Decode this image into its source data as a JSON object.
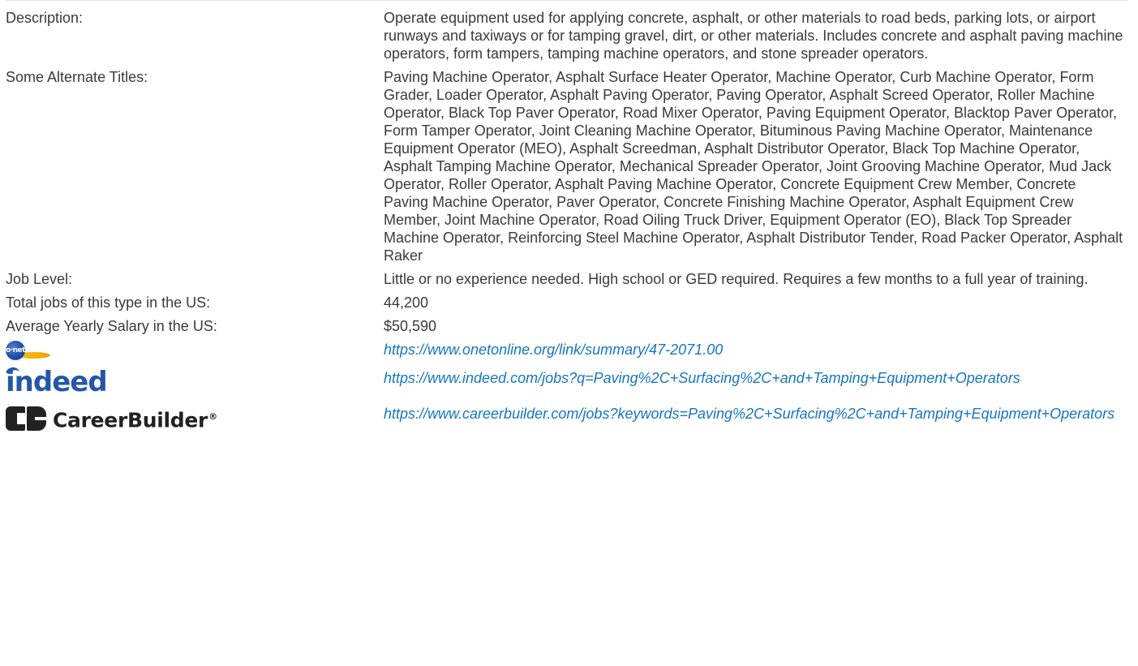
{
  "rows": [
    {
      "label": "Description:",
      "value": "Operate equipment used for applying concrete, asphalt, or other materials to road beds, parking lots, or airport runways and taxiways or for tamping gravel, dirt, or other materials. Includes concrete and asphalt paving machine operators, form tampers, tamping machine operators, and stone spreader operators."
    },
    {
      "label": "Some Alternate Titles:",
      "value": "Paving Machine Operator, Asphalt Surface Heater Operator, Machine Operator, Curb Machine Operator, Form Grader, Loader Operator, Asphalt Paving Operator, Paving Operator, Asphalt Screed Operator, Roller Machine Operator, Black Top Paver Operator, Road Mixer Operator, Paving Equipment Operator, Blacktop Paver Operator, Form Tamper Operator, Joint Cleaning Machine Operator, Bituminous Paving Machine Operator, Maintenance Equipment Operator (MEO), Asphalt Screedman, Asphalt Distributor Operator, Black Top Machine Operator, Asphalt Tamping Machine Operator, Mechanical Spreader Operator, Joint Grooving Machine Operator, Mud Jack Operator, Roller Operator, Asphalt Paving Machine Operator, Concrete Equipment Crew Member, Concrete Paving Machine Operator, Paver Operator, Concrete Finishing Machine Operator, Asphalt Equipment Crew Member, Joint Machine Operator, Road Oiling Truck Driver, Equipment Operator (EO), Black Top Spreader Machine Operator, Reinforcing Steel Machine Operator, Asphalt Distributor Tender, Road Packer Operator, Asphalt Raker"
    },
    {
      "label": "Job Level:",
      "value": "Little or no experience needed. High school or GED required. Requires a few months to a full year of training."
    },
    {
      "label": "Total jobs of this type in the US:",
      "value": "44,200"
    },
    {
      "label": "Average Yearly Salary in the US:",
      "value": "$50,590"
    }
  ],
  "links": {
    "onet": {
      "logo_text": "o·net",
      "url": "https://www.onetonline.org/link/summary/47-2071.00"
    },
    "indeed": {
      "logo_text": "indeed",
      "url": "https://www.indeed.com/jobs?q=Paving%2C+Surfacing%2C+and+Tamping+Equipment+Operators"
    },
    "careerbuilder": {
      "logo_text": "CareerBuilder",
      "logo_reg": "®",
      "url": "https://www.careerbuilder.com/jobs?keywords=Paving%2C+Surfacing%2C+and+Tamping+Equipment+Operators"
    }
  },
  "colors": {
    "text": "#3a3a3a",
    "link": "#1576c4",
    "indeed_blue": "#2557a7",
    "onet_blue": "#1e4fa8",
    "onet_gold": "#f5c218",
    "careerbuilder_black": "#222222"
  },
  "icons": {
    "onet": "onet-logo-icon",
    "indeed": "indeed-logo-icon",
    "careerbuilder": "careerbuilder-logo-icon"
  }
}
